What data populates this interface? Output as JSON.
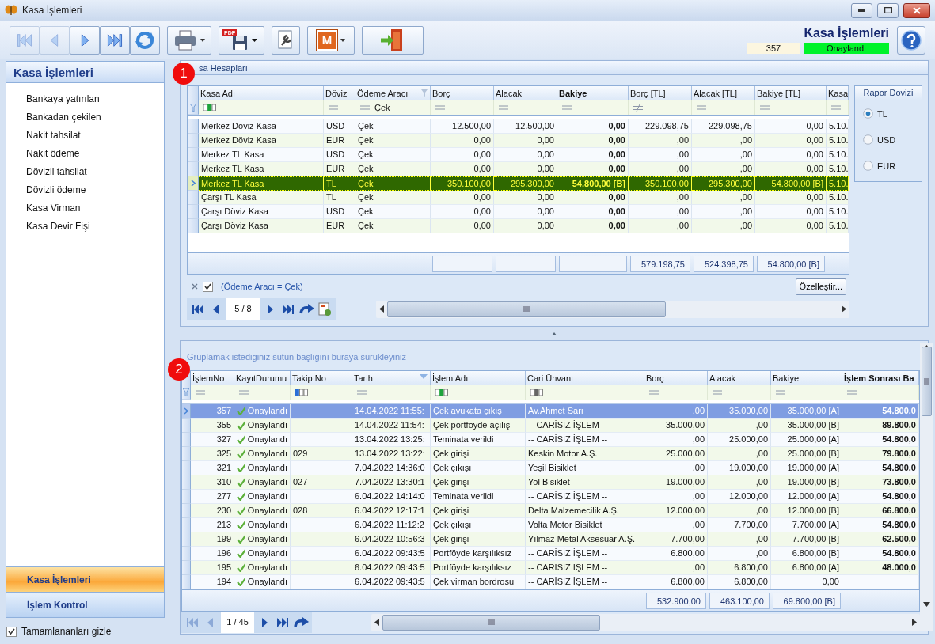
{
  "window": {
    "title": "Kasa İşlemleri"
  },
  "toolbar": {
    "buttons": [
      {
        "kind": "first",
        "disabled": true
      },
      {
        "kind": "prev",
        "disabled": true
      },
      {
        "kind": "next",
        "disabled": false
      },
      {
        "kind": "last",
        "disabled": false
      },
      {
        "kind": "refresh",
        "disabled": false
      },
      {
        "kind": "print",
        "disabled": false
      },
      {
        "kind": "pdf",
        "disabled": false,
        "label": "PDF"
      },
      {
        "kind": "tool",
        "disabled": false
      },
      {
        "kind": "m",
        "disabled": false,
        "label": "M"
      },
      {
        "kind": "exit",
        "disabled": false
      }
    ],
    "heading": "Kasa İşlemleri",
    "record_no": "357",
    "status": "Onaylandı"
  },
  "sidebar": {
    "title": "Kasa İşlemleri",
    "items": [
      "Bankaya yatırılan",
      "Bankadan çekilen",
      "Nakit tahsilat",
      "Nakit ödeme",
      "Dövizli tahsilat",
      "Dövizli ödeme",
      "Kasa Virman",
      "Kasa Devir Fişi"
    ],
    "sections": [
      {
        "label": "Kasa İşlemleri",
        "selected": true
      },
      {
        "label": "İşlem Kontrol",
        "selected": false
      }
    ],
    "hide_completed": {
      "label": "Tamamlananları gizle",
      "checked": true
    }
  },
  "accounts": {
    "badge": "1",
    "title": "sa Hesapları",
    "columns": [
      {
        "label": "Kasa Adı",
        "kind": "text",
        "bold": false,
        "filtered": false,
        "sorted": false,
        "filter": {
          "kind": "text"
        }
      },
      {
        "label": "Döviz",
        "kind": "text",
        "bold": false,
        "filtered": false,
        "sorted": false,
        "filter": {
          "kind": "equals"
        }
      },
      {
        "label": "Ödeme Aracı",
        "kind": "text",
        "bold": false,
        "filtered": true,
        "sorted": false,
        "filter": {
          "kind": "equals",
          "value": "Çek"
        }
      },
      {
        "label": "Borç",
        "kind": "amount",
        "bold": false,
        "filtered": false,
        "sorted": false,
        "filter": {
          "kind": "equals"
        }
      },
      {
        "label": "Alacak",
        "kind": "amount",
        "bold": false,
        "filtered": false,
        "sorted": false,
        "filter": {
          "kind": "equals"
        }
      },
      {
        "label": "Bakiye",
        "kind": "amount",
        "bold": true,
        "filtered": false,
        "sorted": false,
        "filter": {
          "kind": "equals"
        }
      },
      {
        "label": "Borç [TL]",
        "kind": "amount",
        "bold": false,
        "filtered": false,
        "sorted": false,
        "total": "579.198,75",
        "filter": {
          "kind": "not_equals"
        }
      },
      {
        "label": "Alacak [TL]",
        "kind": "amount",
        "bold": false,
        "filtered": false,
        "sorted": false,
        "total": "524.398,75",
        "filter": {
          "kind": "equals"
        }
      },
      {
        "label": "Bakiye [TL]",
        "kind": "amount",
        "bold": false,
        "filtered": false,
        "sorted": false,
        "total": "54.800,00 [B]",
        "filter": {
          "kind": "equals"
        }
      },
      {
        "label": "Kasa",
        "kind": "text",
        "bold": false,
        "filtered": false,
        "sorted": false,
        "filter": {
          "kind": "equals"
        }
      }
    ],
    "rows": [
      {
        "selected": false,
        "cells": [
          "Merkez Döviz Kasa",
          "USD",
          "Çek",
          "12.500,00",
          "12.500,00",
          "0,00",
          "229.098,75",
          "229.098,75",
          "0,00",
          "5.10."
        ]
      },
      {
        "selected": false,
        "cells": [
          "Merkez Döviz Kasa",
          "EUR",
          "Çek",
          "0,00",
          "0,00",
          "0,00",
          ",00",
          ",00",
          "0,00",
          "5.10."
        ]
      },
      {
        "selected": false,
        "cells": [
          "Merkez TL Kasa",
          "USD",
          "Çek",
          "0,00",
          "0,00",
          "0,00",
          ",00",
          ",00",
          "0,00",
          "5.10."
        ]
      },
      {
        "selected": false,
        "cells": [
          "Merkez TL Kasa",
          "EUR",
          "Çek",
          "0,00",
          "0,00",
          "0,00",
          ",00",
          ",00",
          "0,00",
          "5.10."
        ]
      },
      {
        "selected": true,
        "cells": [
          "Merkez TL Kasa",
          "TL",
          "Çek",
          "350.100,00",
          "295.300,00",
          "54.800,00 [B]",
          "350.100,00",
          "295.300,00",
          "54.800,00 [B]",
          "5.10."
        ]
      },
      {
        "selected": false,
        "cells": [
          "Çarşı TL Kasa",
          "TL",
          "Çek",
          "0,00",
          "0,00",
          "0,00",
          ",00",
          ",00",
          "0,00",
          "5.10."
        ]
      },
      {
        "selected": false,
        "cells": [
          "Çarşı Döviz Kasa",
          "USD",
          "Çek",
          "0,00",
          "0,00",
          "0,00",
          ",00",
          ",00",
          "0,00",
          "5.10."
        ]
      },
      {
        "selected": false,
        "cells": [
          "Çarşı Döviz Kasa",
          "EUR",
          "Çek",
          "0,00",
          "0,00",
          "0,00",
          ",00",
          ",00",
          "0,00",
          "5.10."
        ]
      }
    ],
    "active_filter": {
      "enabled": true,
      "text": "(Ödeme Aracı = Çek)"
    },
    "customize": "Özelleştir...",
    "pager": {
      "text": "5 / 8",
      "buttons": [
        {
          "kind": "first",
          "disabled": false
        },
        {
          "kind": "prev",
          "disabled": false
        },
        {
          "kind": "next",
          "disabled": false
        },
        {
          "kind": "last",
          "disabled": false
        },
        {
          "kind": "redo",
          "disabled": false
        },
        {
          "kind": "export",
          "disabled": false
        }
      ]
    }
  },
  "report_currency": {
    "title": "Rapor Dovizi",
    "options": [
      {
        "label": "TL",
        "selected": true
      },
      {
        "label": "USD",
        "selected": false
      },
      {
        "label": "EUR",
        "selected": false
      }
    ]
  },
  "transactions": {
    "badge": "2",
    "group_hint": "Gruplamak istediğiniz sütun başlığını buraya sürükleyiniz",
    "columns": [
      {
        "label": "İşlemNo",
        "kind": "number",
        "bold": false,
        "filtered": false,
        "sorted": false,
        "filter": {
          "kind": "equals"
        }
      },
      {
        "label": "KayıtDurumu",
        "kind": "status",
        "bold": false,
        "filtered": false,
        "sorted": false,
        "filter": {
          "kind": "equals"
        }
      },
      {
        "label": "Takip No",
        "kind": "text",
        "bold": false,
        "filtered": false,
        "sorted": false,
        "filter": {
          "kind": "text_code"
        }
      },
      {
        "label": "Tarih",
        "kind": "text",
        "bold": false,
        "filtered": false,
        "sorted": true,
        "filter": {
          "kind": "equals"
        }
      },
      {
        "label": "İşlem Adı",
        "kind": "text",
        "bold": false,
        "filtered": false,
        "sorted": false,
        "filter": {
          "kind": "text"
        }
      },
      {
        "label": "Cari Ünvanı",
        "kind": "text",
        "bold": false,
        "filtered": false,
        "sorted": false,
        "filter": {
          "kind": "text_plain"
        }
      },
      {
        "label": "Borç",
        "kind": "amount",
        "bold": false,
        "filtered": false,
        "sorted": false,
        "total": "532.900,00",
        "filter": {
          "kind": "equals"
        }
      },
      {
        "label": "Alacak",
        "kind": "amount",
        "bold": false,
        "filtered": false,
        "sorted": false,
        "total": "463.100,00",
        "filter": {
          "kind": "equals"
        }
      },
      {
        "label": "Bakiye",
        "kind": "amount",
        "bold": false,
        "filtered": false,
        "sorted": false,
        "total": "69.800,00 [B]",
        "filter": {
          "kind": "equals"
        }
      },
      {
        "label": "İşlem Sonrası Ba",
        "kind": "number",
        "bold": true,
        "filtered": false,
        "sorted": false,
        "filter": {
          "kind": "equals"
        }
      }
    ],
    "rows": [
      {
        "selected": true,
        "cells": [
          "357",
          "Onaylandı",
          null,
          "14.04.2022 11:55:",
          "Çek avukata çıkış",
          "Av.Ahmet Sarı",
          ",00",
          "35.000,00",
          "35.000,00 [A]",
          "54.800,0"
        ]
      },
      {
        "selected": false,
        "cells": [
          "355",
          "Onaylandı",
          null,
          "14.04.2022 11:54:",
          "Çek portföyde açılış",
          "-- CARİSİZ İŞLEM --",
          "35.000,00",
          ",00",
          "35.000,00 [B]",
          "89.800,0"
        ]
      },
      {
        "selected": false,
        "cells": [
          "327",
          "Onaylandı",
          null,
          "13.04.2022 13:25:",
          "Teminata verildi",
          "-- CARİSİZ İŞLEM --",
          ",00",
          "25.000,00",
          "25.000,00 [A]",
          "54.800,0"
        ]
      },
      {
        "selected": false,
        "cells": [
          "325",
          "Onaylandı",
          "029",
          "13.04.2022 13:22:",
          "Çek girişi",
          "Keskin Motor A.Ş.",
          "25.000,00",
          ",00",
          "25.000,00 [B]",
          "79.800,0"
        ]
      },
      {
        "selected": false,
        "cells": [
          "321",
          "Onaylandı",
          null,
          "7.04.2022 14:36:0",
          "Çek çıkışı",
          "Yeşil Bisiklet",
          ",00",
          "19.000,00",
          "19.000,00 [A]",
          "54.800,0"
        ]
      },
      {
        "selected": false,
        "cells": [
          "310",
          "Onaylandı",
          "027",
          "7.04.2022 13:30:1",
          "Çek girişi",
          "Yol Bisiklet",
          "19.000,00",
          ",00",
          "19.000,00 [B]",
          "73.800,0"
        ]
      },
      {
        "selected": false,
        "cells": [
          "277",
          "Onaylandı",
          null,
          "6.04.2022 14:14:0",
          "Teminata verildi",
          "-- CARİSİZ İŞLEM --",
          ",00",
          "12.000,00",
          "12.000,00 [A]",
          "54.800,0"
        ]
      },
      {
        "selected": false,
        "cells": [
          "230",
          "Onaylandı",
          "028",
          "6.04.2022 12:17:1",
          "Çek girişi",
          "Delta Malzemecilik A.Ş.",
          "12.000,00",
          ",00",
          "12.000,00 [B]",
          "66.800,0"
        ]
      },
      {
        "selected": false,
        "cells": [
          "213",
          "Onaylandı",
          null,
          "6.04.2022 11:12:2",
          "Çek çıkışı",
          "Volta Motor Bisiklet",
          ",00",
          "7.700,00",
          "7.700,00 [A]",
          "54.800,0"
        ]
      },
      {
        "selected": false,
        "cells": [
          "199",
          "Onaylandı",
          null,
          "6.04.2022 10:56:3",
          "Çek girişi",
          "Yılmaz Metal Aksesuar A.Ş.",
          "7.700,00",
          ",00",
          "7.700,00 [B]",
          "62.500,0"
        ]
      },
      {
        "selected": false,
        "cells": [
          "196",
          "Onaylandı",
          null,
          "6.04.2022 09:43:5",
          "Portföyde karşılıksız",
          "-- CARİSİZ İŞLEM --",
          "6.800,00",
          ",00",
          "6.800,00 [B]",
          "54.800,0"
        ]
      },
      {
        "selected": false,
        "cells": [
          "195",
          "Onaylandı",
          null,
          "6.04.2022 09:43:5",
          "Portföyde karşılıksız",
          "-- CARİSİZ İŞLEM --",
          ",00",
          "6.800,00",
          "6.800,00 [A]",
          "48.000,0"
        ]
      },
      {
        "selected": false,
        "cells": [
          "194",
          "Onaylandı",
          null,
          "6.04.2022 09:43:5",
          "Çek virman bordrosu",
          "-- CARİSİZ İŞLEM --",
          "6.800,00",
          "6.800,00",
          "0,00",
          null
        ]
      }
    ],
    "pager": {
      "text": "1 / 45",
      "buttons": [
        {
          "kind": "first",
          "disabled": true
        },
        {
          "kind": "prev",
          "disabled": true
        },
        {
          "kind": "next",
          "disabled": false
        },
        {
          "kind": "last",
          "disabled": false
        },
        {
          "kind": "redo",
          "disabled": false
        }
      ]
    }
  }
}
